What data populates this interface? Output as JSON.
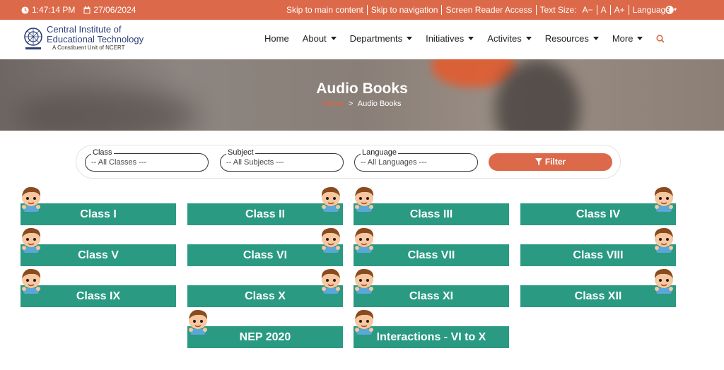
{
  "topbar": {
    "time": "1:47:14 PM",
    "date": "27/06/2024",
    "links": [
      "Skip to main content",
      "Skip to navigation",
      "Screen Reader Access",
      "Text Size:",
      "A−",
      "A",
      "A+",
      "Language"
    ]
  },
  "logo": {
    "line1": "Central Institute of",
    "line2": "Educational Technology",
    "line3": "A Constituent Unit of NCERT"
  },
  "nav": {
    "items": [
      "Home",
      "About",
      "Departments",
      "Initiatives",
      "Activites",
      "Resources",
      "More"
    ]
  },
  "hero": {
    "title": "Audio Books",
    "crumb_home": "Home",
    "crumb_sep": ">",
    "crumb_current": "Audio Books"
  },
  "filters": {
    "class_label": "Class",
    "class_value": "-- All Classes ---",
    "subject_label": "Subject",
    "subject_value": "-- All Subjects ---",
    "language_label": "Language",
    "language_value": "-- All Languages ---",
    "button": "Filter"
  },
  "cards": [
    "Class I",
    "Class II",
    "Class III",
    "Class IV",
    "Class V",
    "Class VI",
    "Class VII",
    "Class VIII",
    "Class IX",
    "Class X",
    "Class XI",
    "Class XII",
    "NEP 2020",
    "Interactions - VI to X"
  ],
  "colors": {
    "accent": "#dc6a4a",
    "card": "#2a9a82"
  }
}
